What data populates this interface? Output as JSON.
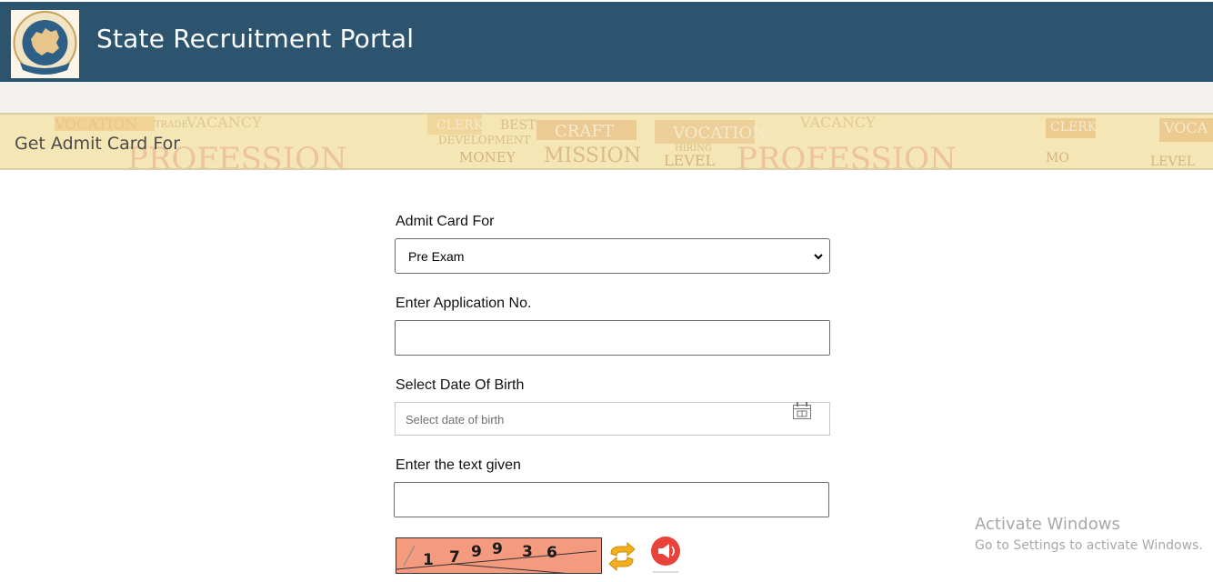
{
  "header": {
    "title": "State Recruitment Portal",
    "logo": {
      "icon": "rajasthan-emblem-logo",
      "ring_text_top": "State Recruitment Portal",
      "ring_text_bottom": "Rajasthan"
    }
  },
  "banner": {
    "title": "Get Admit Card For",
    "background_words": [
      "VOCATION",
      "TRADE",
      "VACANCY",
      "CLERK",
      "BEST",
      "DEVELOPMENT",
      "MONEY",
      "CRAFT",
      "MISSION",
      "PROFESSION",
      "HIRING",
      "LEVEL",
      "JOB"
    ]
  },
  "form": {
    "admit_card_for": {
      "label": "Admit Card For",
      "selected": "Pre Exam"
    },
    "application_no": {
      "label": "Enter Application No.",
      "value": ""
    },
    "dob": {
      "label": "Select Date Of Birth",
      "placeholder": "Select date of birth",
      "icon": "calendar-icon"
    },
    "captcha_text": {
      "label": "Enter the text given",
      "value": ""
    },
    "captcha": {
      "digits": [
        "1",
        "7",
        "9",
        "9",
        "3",
        "6"
      ],
      "refresh_icon": "refresh-icon",
      "audio_icon": "audio-speaker-icon"
    }
  },
  "watermark": {
    "line1": "Activate Windows",
    "line2": "Go to Settings to activate Windows."
  },
  "colors": {
    "header_bg": "#2c546e",
    "banner_bg": "#f4e6b3",
    "captcha_bg": "#f39a7f",
    "audio_btn": "#e8433b",
    "refresh_icon": "#f2b01e"
  }
}
